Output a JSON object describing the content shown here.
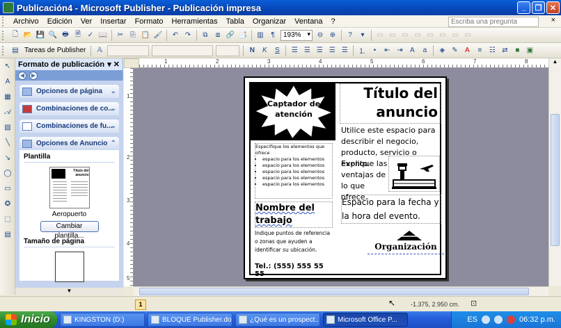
{
  "window": {
    "title": "Publicación4 - Microsoft Publisher - Publicación impresa"
  },
  "menu": {
    "items": [
      "Archivo",
      "Edición",
      "Ver",
      "Insertar",
      "Formato",
      "Herramientas",
      "Tabla",
      "Organizar",
      "Ventana",
      "?"
    ],
    "help_placeholder": "Escriba una pregunta",
    "close_doc": "×"
  },
  "toolbar": {
    "zoom": "193%",
    "tasks_label": "Tareas de Publisher"
  },
  "taskpane": {
    "title": "Formato de publicación",
    "sections": [
      "Opciones de página",
      "Combinaciones de co...",
      "Combinaciones de fu...",
      "Opciones de Anuncio"
    ],
    "template_title": "Plantilla",
    "template_name": "Aeropuerto",
    "change_template": "Cambiar plantilla...",
    "page_size_title": "Tamaño de página",
    "thumb_title": "Título del anuncio"
  },
  "rulers": {
    "top": [
      "1",
      "2",
      "3",
      "4",
      "5",
      "6",
      "7",
      "8"
    ],
    "left": [
      "1",
      "2",
      "3",
      "4",
      "5"
    ]
  },
  "ad": {
    "burst": "Captador de atención",
    "title": "Título del anuncio",
    "description": "Utilice este espacio para describir el negocio, producto, servicio o evento.",
    "explain": "Explique las ventajas de lo que ofrece.",
    "bullets_intro": "Especifique los elementos que ofrece",
    "bullets": [
      "espacio para los elementos",
      "espacio para los elementos",
      "espacio para los elementos",
      "espacio para los elementos",
      "espacio para los elementos"
    ],
    "job": "Nombre del trabajo",
    "event": "Espacio para la fecha y la hora del evento.",
    "points": "Indique puntos de referencia o zonas que ayuden a identificar su ubicación.",
    "phone": "Tel.: (555) 555 55 55",
    "org": "Organización"
  },
  "status": {
    "page": "1",
    "coords": "-1.375, 2.950 cm."
  },
  "taskbar": {
    "start": "Inicio",
    "tasks": [
      "KINGSTON (D:)",
      "BLOQUE Publisher.do...",
      "¿Qué es un prospect...",
      "Microsoft Office P..."
    ],
    "lang": "ES",
    "clock": "06:32 p.m."
  }
}
